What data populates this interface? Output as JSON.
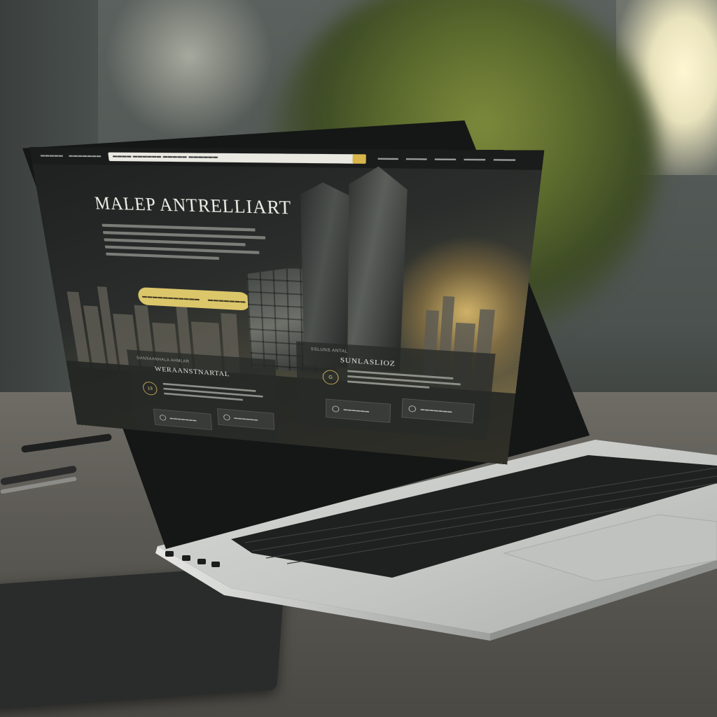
{
  "browser": {
    "nav_left": [
      "▬▬▬▬▬",
      "▬▬▬▬▬▬▬"
    ],
    "address": "▬▬▬▬  ▬▬▬▬▬▬  ▬▬▬▬▬  ▬▬▬▬▬▬",
    "nav_right": [
      "▬▬▬▬",
      "▬▬▬▬",
      "▬▬▬▬",
      "▬▬▬▬",
      "▬▬▬▬"
    ]
  },
  "hero": {
    "title": "MALEP ANTRELLIART",
    "cta_left": "▬▬▬▬▬▬▬▬▬▬▬",
    "cta_right": "▬▬▬▬▬▬▬"
  },
  "panel_left": {
    "kicker": "GANSAANHALA AHMLAR",
    "title": "WERAANSTNARTAL",
    "ring": "13"
  },
  "panel_right": {
    "kicker": "SSLUNS ANTAL",
    "title": "SUNLASLIOZ",
    "ring": "G"
  },
  "cards": [
    {
      "label": "▬▬▬▬▬▬▬"
    },
    {
      "label": "▬▬▬▬▬▬"
    },
    {
      "label": "▬▬▬▬▬▬"
    },
    {
      "label": "▬▬▬▬▬▬▬"
    }
  ],
  "colors": {
    "accent_gold": "#dcc66a",
    "screen_dark": "#1d201f",
    "laptop_silver": "#c9cbc8"
  }
}
